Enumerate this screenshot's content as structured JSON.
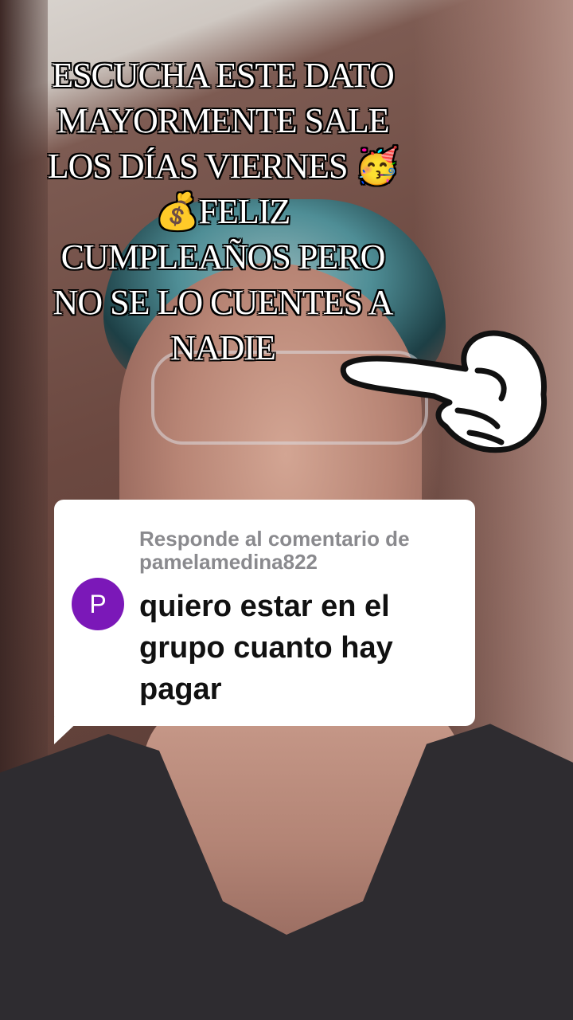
{
  "caption": {
    "text": "ESCUCHA ESTE DATO\nMAYORMENTE SALE\nLOS DÍAS VIERNES 🥳\n💰FELIZ\nCUMPLEAÑOS PERO\nNO SE LO CUENTES A\nNADIE"
  },
  "reply": {
    "header_line1": "Responde al comentario de",
    "username": "pamelamedina822",
    "avatar_letter": "P",
    "avatar_color": "#7b18b8",
    "comment": "quiero estar en el grupo cuanto hay pagar"
  },
  "icons": {
    "pointing_hand": "pointing-hand-sticker"
  }
}
